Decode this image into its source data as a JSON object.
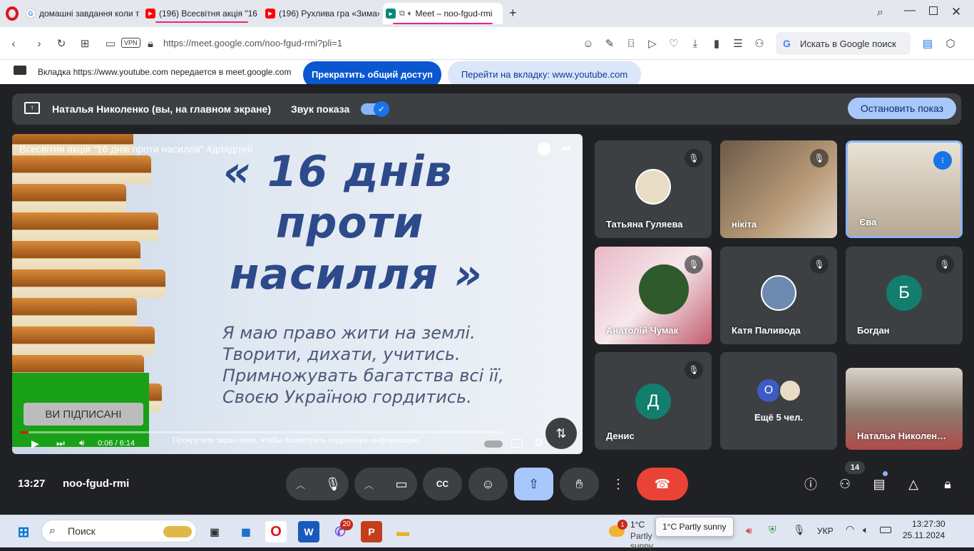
{
  "browser": {
    "tabs": [
      {
        "title": "домашні завдання коли т",
        "icon": "google-icon"
      },
      {
        "title": "(196) Всесвітня акція \"16",
        "icon": "youtube-icon"
      },
      {
        "title": "(196) Рухлива гра «Зима»",
        "icon": "youtube-icon"
      },
      {
        "title": "Meet – noo-fgud-rmi",
        "icon": "meet-icon"
      }
    ],
    "new_tab": "+",
    "vpn_label": "VPN",
    "url": "https://meet.google.com/noo-fgud-rmi?pli=1",
    "search_box": "Искать в Google поиск"
  },
  "share_banner": {
    "text": "Вкладка https://www.youtube.com передается в meet.google.com",
    "stop_button": "Прекратить общий доступ",
    "goto_button": "Перейти на вкладку: www.youtube.com"
  },
  "presentation_bar": {
    "presenter": "Наталья Николенко (вы, на главном экране)",
    "sound_label": "Звук показа",
    "sound_enabled": true,
    "stop_button": "Остановить показ"
  },
  "video": {
    "title": "Всесвітня акція \"16 днів проти насилля\".#длядітей",
    "headline": [
      "« 16 днів",
      "проти",
      "насилля »"
    ],
    "poem": [
      "Я маю право жити на землі.",
      "Творити, дихати, учитись.",
      "Примножувать багатства всі її,",
      "Своєю Україною гордитись."
    ],
    "subscribed_label": "ВИ ПІДПИСАНІ",
    "time": "0:06 / 6:14",
    "progress": 0.016,
    "scroll_hint": "Прокрутите экран вниз, чтобы посмотреть подробную информацию"
  },
  "participants": [
    {
      "name": "Татьяна Гуляева",
      "muted": true,
      "kind": "avatar",
      "color": "#e8dcc4"
    },
    {
      "name": "нікіта",
      "muted": true,
      "kind": "camera",
      "color": "#8a6d52"
    },
    {
      "name": "Єва",
      "muted": false,
      "speaking": true,
      "kind": "camera",
      "color": "#c8b8a0"
    },
    {
      "name": "Анатолій Чумак",
      "muted": true,
      "kind": "camera",
      "color": "#d9a9b4"
    },
    {
      "name": "Катя Паливода",
      "muted": true,
      "kind": "avatar",
      "color": "#6f8ab0"
    },
    {
      "name": "Богдан",
      "muted": true,
      "kind": "letter",
      "letter": "Б",
      "color": "#137d6e"
    },
    {
      "name": "Денис",
      "muted": true,
      "kind": "letter",
      "letter": "Д",
      "color": "#137d6e"
    },
    {
      "name": "Ещё 5 чел.",
      "muted": false,
      "kind": "more",
      "letter": "О",
      "color": "#3c5bc4"
    },
    {
      "name": "Наталья Николен…",
      "muted": false,
      "kind": "camera",
      "color": "#8c7a6c"
    }
  ],
  "meeting": {
    "time": "13:27",
    "code": "noo-fgud-rmi",
    "people_count": "14"
  },
  "taskbar": {
    "search_label": "Поиск",
    "viber_badge": "20",
    "weather_temp": "1°C",
    "weather_desc": "Partly sunny",
    "weather_badge": "1",
    "weather_tooltip": "1°C Partly sunny",
    "language": "УКР",
    "time": "13:27:30",
    "date": "25.11.2024"
  },
  "colors": {
    "meet_bg": "#202124",
    "accent_blue": "#0b57d0",
    "hangup_red": "#ea4335",
    "present_active": "#a8c7fa"
  }
}
